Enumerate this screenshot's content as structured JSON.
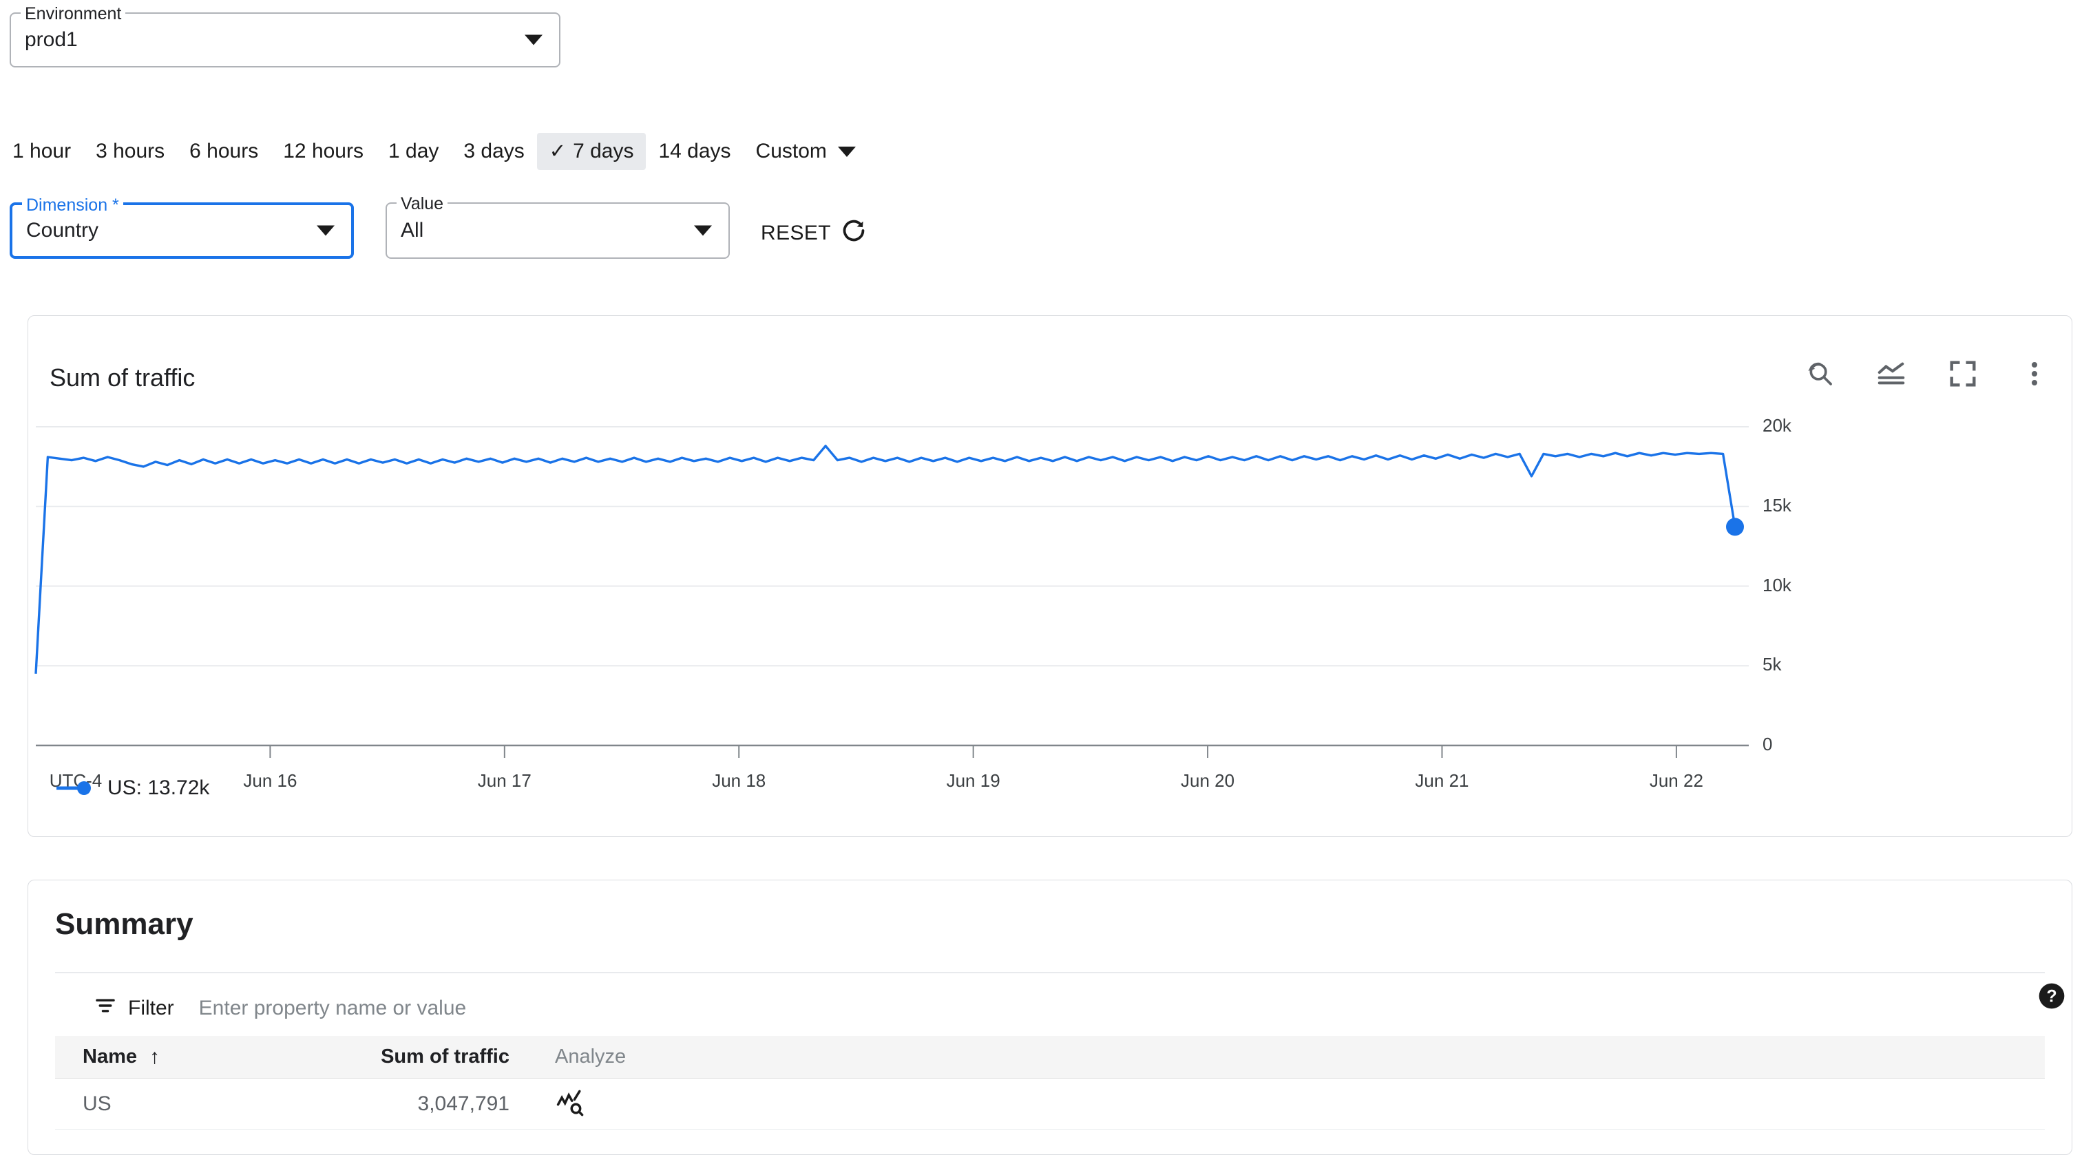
{
  "environment": {
    "label": "Environment",
    "value": "prod1",
    "caret_icon": "chevron-down-icon"
  },
  "time_range": {
    "items": [
      {
        "label": "1 hour",
        "selected": false
      },
      {
        "label": "3 hours",
        "selected": false
      },
      {
        "label": "6 hours",
        "selected": false
      },
      {
        "label": "12 hours",
        "selected": false
      },
      {
        "label": "1 day",
        "selected": false
      },
      {
        "label": "3 days",
        "selected": false
      },
      {
        "label": "7 days",
        "selected": true
      },
      {
        "label": "14 days",
        "selected": false
      },
      {
        "label": "Custom",
        "selected": false
      }
    ],
    "check_glyph": "✓",
    "selected": "7 days"
  },
  "filters": {
    "dimension": {
      "label": "Dimension *",
      "value": "Country",
      "focused": true
    },
    "value": {
      "label": "Value",
      "value": "All",
      "focused": false
    },
    "reset": {
      "label": "RESET",
      "icon": "refresh-icon"
    }
  },
  "chart_card": {
    "title": "Sum of traffic",
    "icons": [
      {
        "name": "reset-zoom-icon"
      },
      {
        "name": "chart-type-icon"
      },
      {
        "name": "fullscreen-icon"
      },
      {
        "name": "more-options-icon"
      }
    ],
    "legend": [
      {
        "label": "US: 13.72k",
        "color": "#1a73e8"
      }
    ]
  },
  "chart_data": {
    "type": "line",
    "title": "Sum of traffic",
    "xlabel": "",
    "ylabel": "",
    "timezone_label": "UTC-4",
    "grid": true,
    "legend_position": "bottom-left",
    "ylim": [
      0,
      20000
    ],
    "yticks": [
      0,
      5000,
      10000,
      15000,
      20000
    ],
    "ytick_labels": [
      "0",
      "5k",
      "10k",
      "15k",
      "20k"
    ],
    "xticks": [
      "Jun 16",
      "Jun 17",
      "Jun 18",
      "Jun 19",
      "Jun 20",
      "Jun 21",
      "Jun 22"
    ],
    "series": [
      {
        "name": "US",
        "color": "#1a73e8",
        "last_value_label": "13.72k",
        "last_value": 13720,
        "values": [
          4500,
          18100,
          18000,
          17900,
          18050,
          17850,
          18100,
          17900,
          17650,
          17500,
          17800,
          17600,
          17900,
          17650,
          17950,
          17700,
          17950,
          17700,
          17950,
          17700,
          17900,
          17700,
          17950,
          17700,
          17950,
          17700,
          17950,
          17700,
          17950,
          17750,
          17950,
          17700,
          17950,
          17700,
          17950,
          17750,
          18000,
          17800,
          18000,
          17750,
          18000,
          17800,
          18000,
          17750,
          18000,
          17800,
          18050,
          17800,
          18000,
          17800,
          18050,
          17800,
          18000,
          17800,
          18050,
          17850,
          18000,
          17800,
          18050,
          17850,
          18050,
          17800,
          18050,
          17850,
          18050,
          17900,
          18800,
          17900,
          18050,
          17800,
          18050,
          17850,
          18050,
          17800,
          18050,
          17850,
          18050,
          17800,
          18050,
          17850,
          18050,
          17850,
          18100,
          17850,
          18050,
          17850,
          18100,
          17850,
          18100,
          17900,
          18100,
          17850,
          18100,
          17900,
          18100,
          17850,
          18100,
          17900,
          18150,
          17900,
          18100,
          17900,
          18150,
          17900,
          18150,
          17900,
          18150,
          17950,
          18150,
          17900,
          18150,
          17950,
          18200,
          17950,
          18200,
          17950,
          18200,
          18000,
          18250,
          18000,
          18250,
          18050,
          18300,
          18100,
          18300,
          16900,
          18300,
          18150,
          18300,
          18100,
          18300,
          18150,
          18350,
          18150,
          18350,
          18200,
          18350,
          18250,
          18350,
          18300,
          18350,
          18300,
          13720
        ]
      }
    ],
    "annotations": [
      {
        "type": "spike-up",
        "approx_x": "Jun 18.6",
        "value": 18800
      },
      {
        "type": "dip-down",
        "approx_x": "Jun 22.1",
        "value": 16900
      },
      {
        "type": "end-marker",
        "value": 13720,
        "label": "13.72k"
      }
    ]
  },
  "summary": {
    "title": "Summary",
    "filter": {
      "label": "Filter",
      "icon": "filter-icon",
      "placeholder": "Enter property name or value",
      "value": ""
    },
    "help_icon": "help-icon",
    "table": {
      "columns": [
        {
          "key": "name",
          "label": "Name",
          "sorted": "asc",
          "sort_glyph": "↑"
        },
        {
          "key": "value",
          "label": "Sum of traffic"
        },
        {
          "key": "analyze",
          "label": "Analyze"
        }
      ],
      "rows": [
        {
          "name": "US",
          "value": "3,047,791",
          "analyze_icon": "analyze-icon"
        }
      ]
    }
  }
}
